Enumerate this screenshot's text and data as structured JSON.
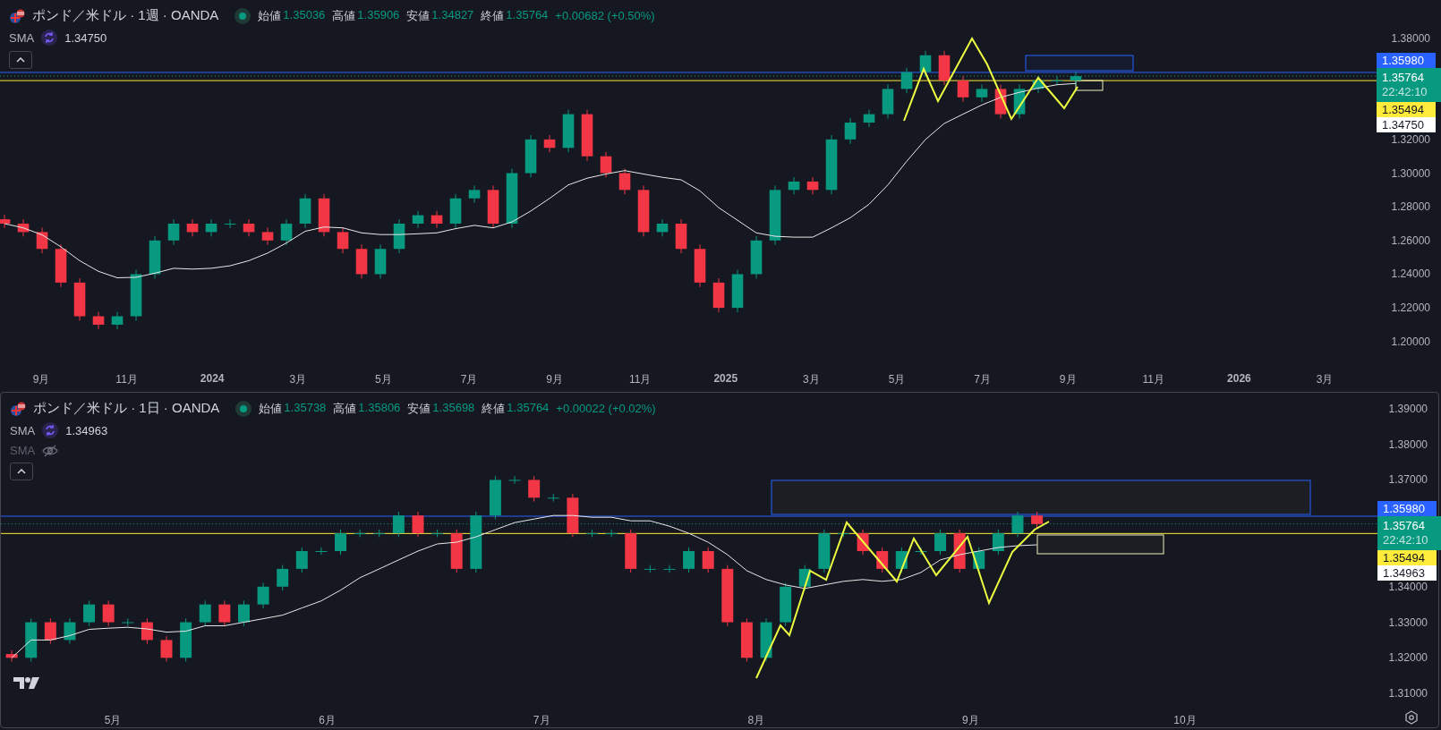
{
  "panes": [
    {
      "title": "ポンド／米ドル · 1週 · OANDA",
      "ohlc": [
        {
          "label": "始値",
          "value": "1.35036"
        },
        {
          "label": "高値",
          "value": "1.35906"
        },
        {
          "label": "安値",
          "value": "1.34827"
        },
        {
          "label": "終値",
          "value": "1.35764"
        }
      ],
      "change": "+0.00682 (+0.50%)",
      "indicators": [
        {
          "name": "SMA",
          "value": "1.34750",
          "visible": true
        }
      ],
      "price_badges": [
        {
          "text": "1.35980",
          "kind": "level",
          "color": "#2962ff"
        },
        {
          "text": "1.35764",
          "subtext": "22:42:10",
          "kind": "last",
          "color": "#089981"
        },
        {
          "text": "1.35494",
          "kind": "level",
          "color": "#ffeb3b"
        },
        {
          "text": "1.34750",
          "kind": "sma",
          "color": "#ffffff"
        }
      ],
      "price_axis": [
        "1.38000",
        "1.32000",
        "1.30000",
        "1.28000",
        "1.26000",
        "1.24000",
        "1.22000",
        "1.20000"
      ],
      "time_axis": [
        {
          "label": "9月",
          "kind": "month"
        },
        {
          "label": "11月",
          "kind": "month"
        },
        {
          "label": "2024",
          "kind": "year"
        },
        {
          "label": "3月",
          "kind": "month"
        },
        {
          "label": "5月",
          "kind": "month"
        },
        {
          "label": "7月",
          "kind": "month"
        },
        {
          "label": "9月",
          "kind": "month"
        },
        {
          "label": "11月",
          "kind": "month"
        },
        {
          "label": "2025",
          "kind": "year"
        },
        {
          "label": "3月",
          "kind": "month"
        },
        {
          "label": "5月",
          "kind": "month"
        },
        {
          "label": "7月",
          "kind": "month"
        },
        {
          "label": "9月",
          "kind": "month"
        },
        {
          "label": "11月",
          "kind": "month"
        },
        {
          "label": "2026",
          "kind": "year"
        },
        {
          "label": "3月",
          "kind": "month"
        }
      ]
    },
    {
      "title": "ポンド／米ドル · 1日 · OANDA",
      "ohlc": [
        {
          "label": "始値",
          "value": "1.35738"
        },
        {
          "label": "高値",
          "value": "1.35806"
        },
        {
          "label": "安値",
          "value": "1.35698"
        },
        {
          "label": "終値",
          "value": "1.35764"
        }
      ],
      "change": "+0.00022 (+0.02%)",
      "indicators": [
        {
          "name": "SMA",
          "value": "1.34963",
          "visible": true
        },
        {
          "name": "SMA",
          "visible": false
        }
      ],
      "price_badges": [
        {
          "text": "1.35980",
          "kind": "level",
          "color": "#2962ff"
        },
        {
          "text": "1.35764",
          "subtext": "22:42:10",
          "kind": "last",
          "color": "#089981"
        },
        {
          "text": "1.35494",
          "kind": "level",
          "color": "#ffeb3b"
        },
        {
          "text": "1.34963",
          "kind": "sma",
          "color": "#ffffff"
        }
      ],
      "price_axis": [
        "1.39000",
        "1.38000",
        "1.37000",
        "1.34000",
        "1.33000",
        "1.32000",
        "1.31000"
      ],
      "time_axis": [
        {
          "label": "5月",
          "kind": "month"
        },
        {
          "label": "6月",
          "kind": "month"
        },
        {
          "label": "7月",
          "kind": "month"
        },
        {
          "label": "8月",
          "kind": "month"
        },
        {
          "label": "9月",
          "kind": "month"
        },
        {
          "label": "10月",
          "kind": "month"
        }
      ]
    }
  ]
}
